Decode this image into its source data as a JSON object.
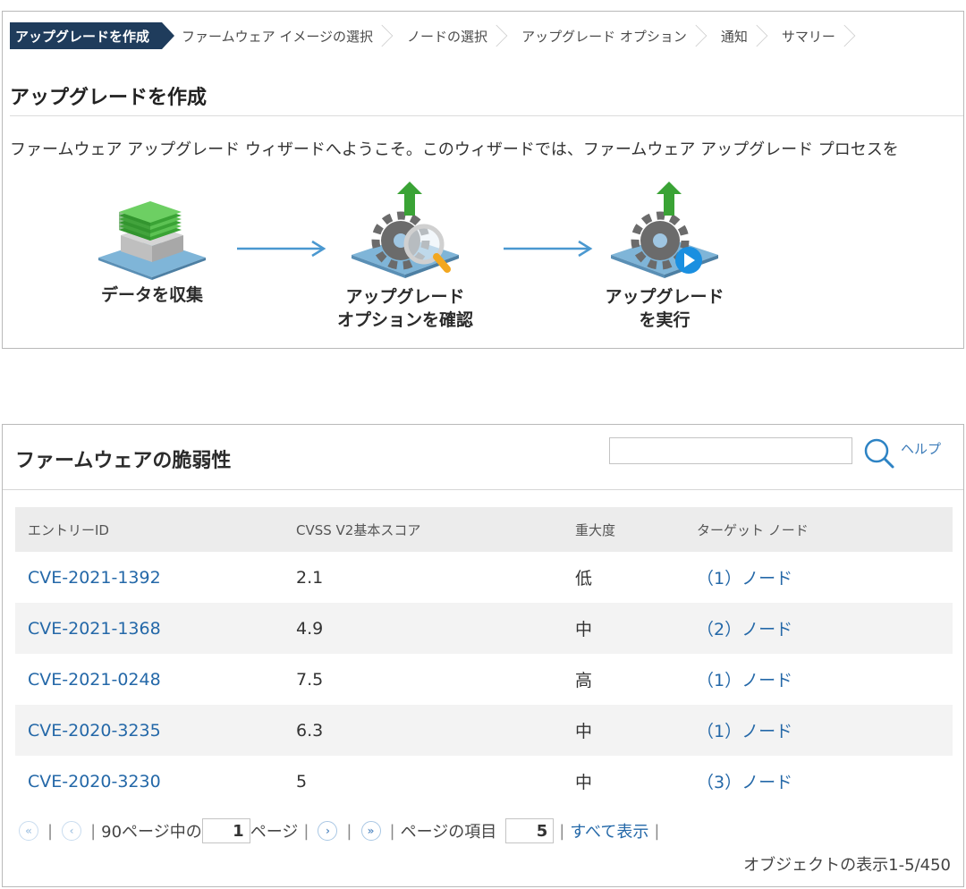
{
  "wizard": {
    "breadcrumbs": [
      {
        "label": "アップグレードを作成"
      },
      {
        "label": "ファームウェア イメージの選択"
      },
      {
        "label": "ノードの選択"
      },
      {
        "label": "アップグレード オプション"
      },
      {
        "label": "通知"
      },
      {
        "label": "サマリー"
      }
    ],
    "title": "アップグレードを作成",
    "intro": "ファームウェア アップグレード ウィザードへようこそ。このウィザードでは、ファームウェア アップグレード プロセスを",
    "steps": [
      {
        "line1": "データを収集",
        "line2": "",
        "icon": "collect-data-icon"
      },
      {
        "line1": "アップグレード",
        "line2": "オプションを確認",
        "icon": "review-options-icon"
      },
      {
        "line1": "アップグレード",
        "line2": "を実行",
        "icon": "run-upgrade-icon"
      }
    ]
  },
  "vulnerabilities": {
    "title": "ファームウェアの脆弱性",
    "search_value": "",
    "help_label": "ヘルプ",
    "columns": [
      "エントリーID",
      "CVSS V2基本スコア",
      "重大度",
      "ターゲット ノード"
    ],
    "rows": [
      {
        "id": "CVE-2021-1392",
        "score": "2.1",
        "severity": "低",
        "nodes": "（1）ノード"
      },
      {
        "id": "CVE-2021-1368",
        "score": "4.9",
        "severity": "中",
        "nodes": "（2）ノード"
      },
      {
        "id": "CVE-2021-0248",
        "score": "7.5",
        "severity": "高",
        "nodes": "（1）ノード"
      },
      {
        "id": "CVE-2020-3235",
        "score": "6.3",
        "severity": "中",
        "nodes": "（1）ノード"
      },
      {
        "id": "CVE-2020-3230",
        "score": "5",
        "severity": "中",
        "nodes": "（3）ノード"
      }
    ],
    "pager": {
      "total_pages_text": "90ページ中の",
      "current_page": "1",
      "page_suffix": "ページ",
      "items_label": "ページの項目",
      "items_per_page": "5",
      "show_all": "すべて表示",
      "separator": "|"
    },
    "status": "オブジェクトの表示1-5/450"
  },
  "colors": {
    "active_crumb": "#1f3c5c",
    "link": "#2468a8",
    "arrow": "#4a98d0",
    "upgrade_green": "#3aa335"
  }
}
